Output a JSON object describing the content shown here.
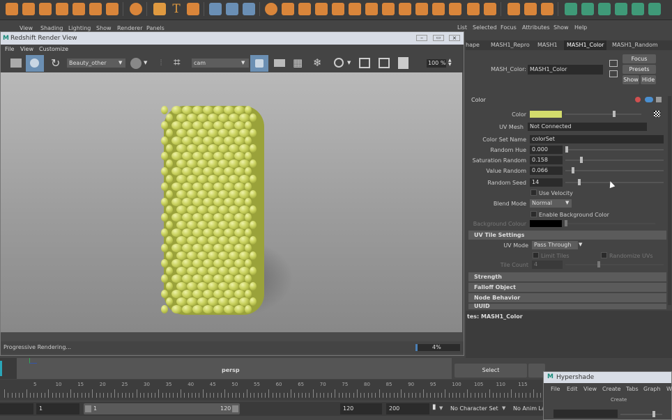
{
  "render_view": {
    "title": "Redshift Render View",
    "menus": [
      "File",
      "View",
      "Customize"
    ],
    "aov_dropdown": "Beauty_other",
    "camera_dropdown": "cam",
    "zoom": "100 %",
    "status": "Progressive Rendering...",
    "progress_text": "4%",
    "progress": 0.04
  },
  "main_menu": [
    "View",
    "Shading",
    "Lighting",
    "Show",
    "Renderer",
    "Panels"
  ],
  "attribute_editor": {
    "menus": [
      "List",
      "Selected",
      "Focus",
      "Attributes",
      "Show",
      "Help"
    ],
    "tabs": [
      "hape",
      "MASH1_Repro",
      "MASH1",
      "MASH1_Color",
      "MASH1_Random"
    ],
    "active_tab": "MASH1_Color",
    "node_label": "MASH_Color:",
    "node_value": "MASH1_Color",
    "buttons": {
      "focus": "Focus",
      "presets": "Presets",
      "show": "Show",
      "hide": "Hide"
    },
    "color_section": "Color",
    "color_swatch": "#d3dc6c",
    "fields": {
      "color_label": "Color",
      "uv_mesh_label": "UV Mesh",
      "uv_mesh_value": "Not Connected",
      "color_set_label": "Color Set Name",
      "color_set_value": "colorSet",
      "random_hue_label": "Random Hue",
      "random_hue_value": "0.000",
      "sat_random_label": "Saturation Random",
      "sat_random_value": "0.158",
      "val_random_label": "Value Random",
      "val_random_value": "0.066",
      "seed_label": "Random Seed",
      "seed_value": "14",
      "use_velocity": "Use Velocity",
      "blend_mode_label": "Blend Mode",
      "blend_mode_value": "Normal",
      "enable_bg": "Enable Background Color",
      "bg_colour_label": "Background Colour"
    },
    "uv_tile_section": "UV Tile Settings",
    "uv_mode_label": "UV Mode",
    "uv_mode_value": "Pass Through",
    "limit_tiles": "Limit Tiles",
    "randomize_uvs": "Randomize UVs",
    "tile_count_label": "Tile Count",
    "tile_count_value": "4",
    "sections": [
      "Strength",
      "Falloff Object",
      "Node Behavior",
      "UUID"
    ],
    "notes_label": "tes: MASH1_Color",
    "select_button": "Select"
  },
  "viewport": {
    "camera_label": "persp"
  },
  "timeline": {
    "ticks": [
      "5",
      "10",
      "15",
      "20",
      "25",
      "30",
      "35",
      "40",
      "45",
      "50",
      "55",
      "60",
      "65",
      "70",
      "75",
      "80",
      "85",
      "90",
      "95",
      "100",
      "105",
      "110",
      "115"
    ]
  },
  "range_bar": {
    "start": "1",
    "range_start": "1",
    "range_end": "120",
    "end": "120",
    "max": "200",
    "character_set": "No Character Set",
    "anim_layer": "No Anim La"
  },
  "hypershade": {
    "title": "Hypershade",
    "menus": [
      "File",
      "Edit",
      "View",
      "Create",
      "Tabs",
      "Graph",
      "W"
    ],
    "create_label": "Create"
  }
}
